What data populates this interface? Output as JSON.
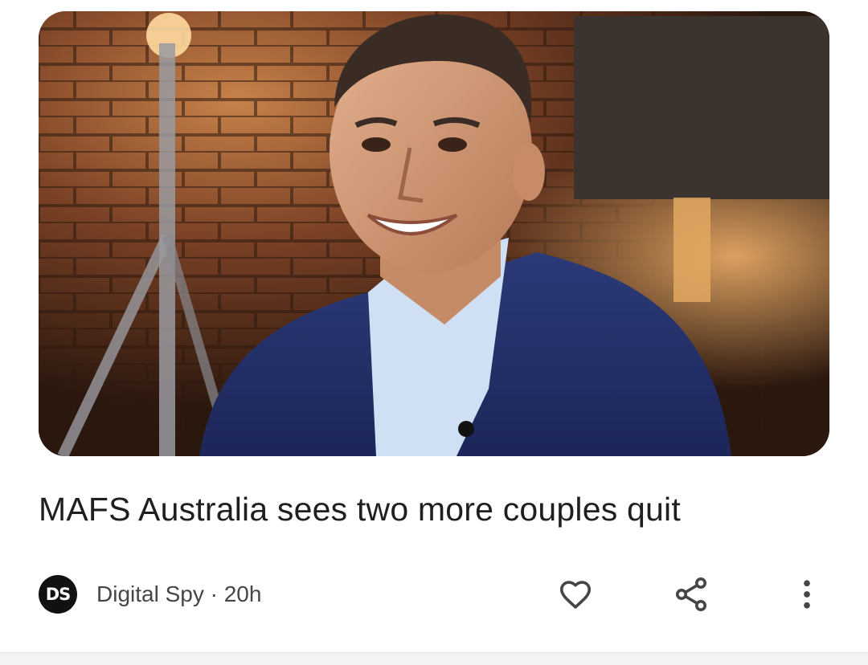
{
  "article": {
    "headline": "MAFS Australia sees two more couples quit",
    "source": {
      "logo_text": "DS",
      "meta": "Digital Spy · 20h"
    },
    "thumbnail_icon": "photo-thumbnail",
    "actions": {
      "like_icon": "heart-outline-icon",
      "share_icon": "share-icon",
      "more_icon": "more-vertical-icon"
    }
  },
  "colors": {
    "headline": "#1f1f1f",
    "meta_text": "#444746",
    "logo_bg": "#111111",
    "icon": "#444746",
    "divider": "#f1f3f4"
  }
}
